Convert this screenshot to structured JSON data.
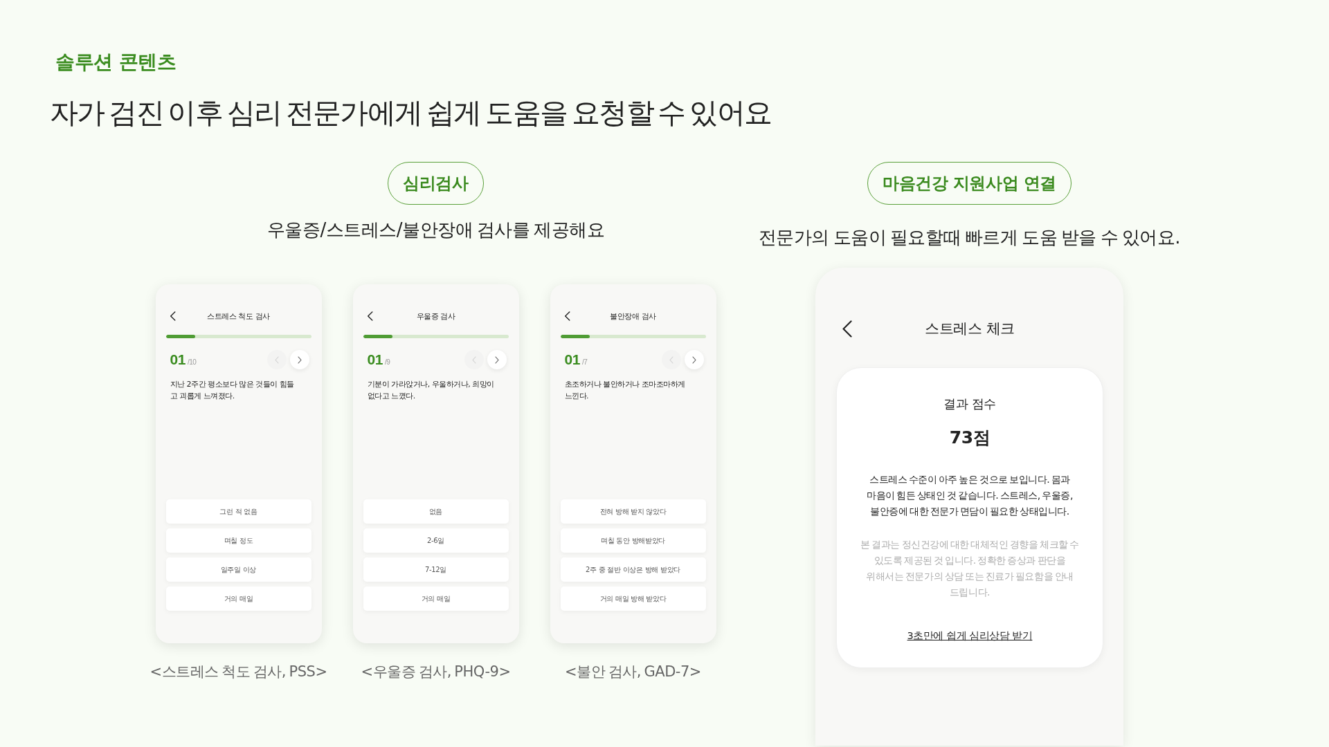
{
  "eyebrow": "솔루션 콘텐츠",
  "headline": "자가 검진 이후 심리 전문가에게 쉽게 도움을 요청할 수 있어요",
  "sections": [
    {
      "kind": "tests",
      "pill": "심리검사",
      "subtitle": "우울증/스트레스/불안장애 검사를 제공해요",
      "phones": [
        {
          "title": "스트레스 척도 검사",
          "progress": {
            "level": 0.2
          },
          "number": "01",
          "total": "/10",
          "nav": [
            {
              "kind": "prev",
              "disabled": true
            },
            {
              "kind": "next",
              "disabled": false
            }
          ],
          "question": "지난 2주간 평소보다 많은 것들이 힘들고 괴롭게 느껴졌다.",
          "answers": [
            "그런 적 없음",
            "며칠 정도",
            "일주일 이상",
            "거의 매일"
          ],
          "caption": "<스트레스 척도 검사, PSS>"
        },
        {
          "title": "우울증 검사",
          "progress": {
            "level": 0.2
          },
          "number": "01",
          "total": "/9",
          "nav": [
            {
              "kind": "prev",
              "disabled": true
            },
            {
              "kind": "next",
              "disabled": false
            }
          ],
          "question": "기분이 가라앉거나, 우울하거나, 희망이 없다고 느꼈다.",
          "answers": [
            "없음",
            "2-6일",
            "7-12일",
            "거의 매일"
          ],
          "caption": "<우울증 검사, PHQ-9>"
        },
        {
          "title": "불안장애 검사",
          "progress": {
            "level": 0.2
          },
          "number": "01",
          "total": "/7",
          "nav": [
            {
              "kind": "prev",
              "disabled": true
            },
            {
              "kind": "next",
              "disabled": false
            }
          ],
          "question": "초조하거나 불안하거나 조마조마하게 느낀다.",
          "answers": [
            "전혀 방해 받지 않았다",
            "며칠 동안 방해받았다",
            "2주 중 절반 이상은 방해 받았다",
            "거의 매일 방해 받았다"
          ],
          "caption": "<불안 검사, GAD-7>"
        }
      ]
    },
    {
      "kind": "result",
      "pill": "마음건강 지원사업 연결",
      "subtitle": "전문가의 도움이 필요할때 빠르게 도움 받을 수 있어요.",
      "phone": {
        "title": "스트레스 체크",
        "card": {
          "label": "결과 점수",
          "score": "73점",
          "message": "스트레스 수준이 아주 높은 것으로 보입니다. 몸과 마음이 힘든 상태인 것 같습니다. 스트레스, 우울증, 불안증에 대한 전문가 면담이 필요한 상태입니다.",
          "disclaimer": "본 결과는 정신건강에 대한 대체적인 경향을 체크할 수 있도록 제공된 것 입니다. 정확한 증상과 판단을 위해서는 전문가의 상담 또는 진료가 필요함을 안내 드립니다.",
          "link": "3초만에 쉽게 심리상담 받기"
        }
      }
    }
  ]
}
